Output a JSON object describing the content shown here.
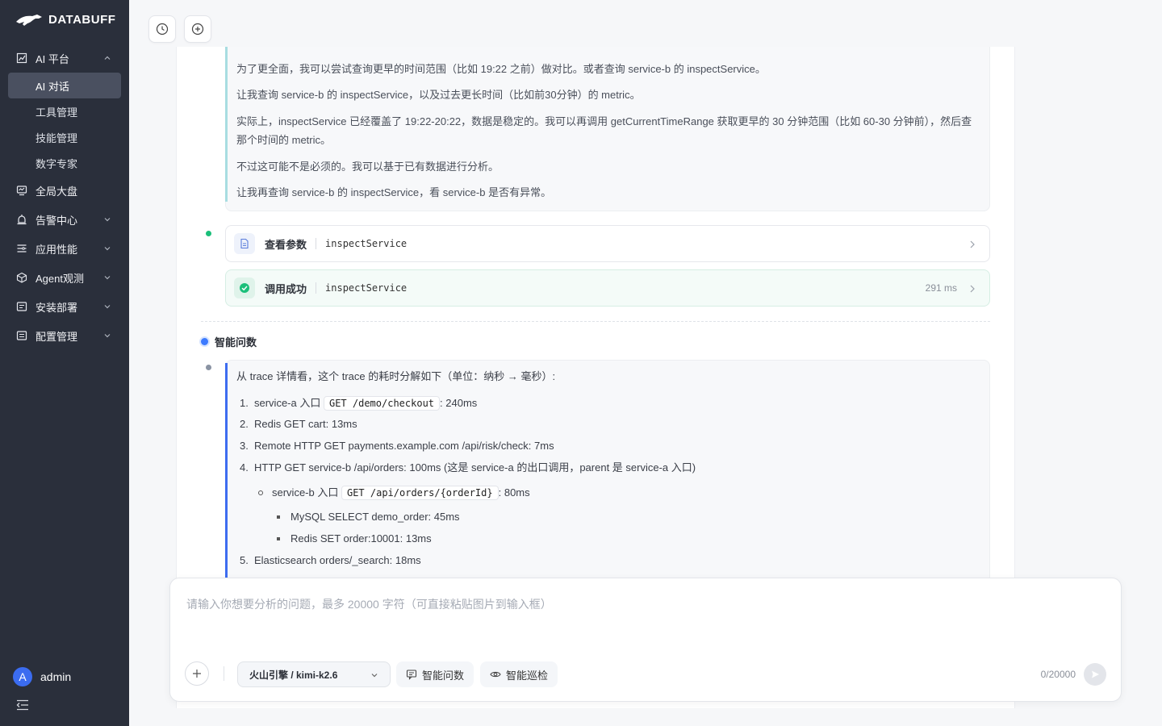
{
  "app": {
    "brand": "DATABUFF",
    "user": "admin",
    "user_initial": "A"
  },
  "sidebar": {
    "groups": [
      {
        "label": "AI 平台",
        "icon": "chart-line-icon",
        "expanded": true
      },
      {
        "label": "全局大盘",
        "icon": "monitor-icon"
      },
      {
        "label": "告警中心",
        "icon": "alarm-icon"
      },
      {
        "label": "应用性能",
        "icon": "list-icon"
      },
      {
        "label": "Agent观测",
        "icon": "cube-icon"
      },
      {
        "label": "安装部署",
        "icon": "document-icon"
      },
      {
        "label": "配置管理",
        "icon": "settings-doc-icon"
      }
    ],
    "ai_items": [
      "AI 对话",
      "工具管理",
      "技能管理",
      "数字专家"
    ],
    "active_item": "AI 对话"
  },
  "topbar": {
    "history_icon": "history-icon",
    "new_chat_icon": "plus-circle-icon"
  },
  "thinking": {
    "lines": [
      "为了更全面，我可以尝试查询更早的时间范围（比如 19:22 之前）做对比。或者查询 service-b 的 inspectService。",
      "让我查询 service-b 的 inspectService，以及过去更长时间（比如前30分钟）的 metric。",
      "实际上，inspectService 已经覆盖了 19:22-20:22，数据是稳定的。我可以再调用 getCurrentTimeRange 获取更早的 30 分钟范围（比如 60-30 分钟前），然后查那个时间的 metric。",
      "不过这可能不是必须的。我可以基于已有数据进行分析。",
      "让我再查询 service-b 的 inspectService，看 service-b 是否有异常。"
    ]
  },
  "tool_calls": [
    {
      "label": "查看参数",
      "name": "inspectService",
      "status": "params"
    },
    {
      "label": "调用成功",
      "name": "inspectService",
      "status": "success",
      "time": "291 ms"
    }
  ],
  "section": {
    "title": "智能问数"
  },
  "answer": {
    "intro": "从 trace 详情看，这个 trace 的耗时分解如下（单位：纳秒 → 毫秒）:",
    "items": [
      {
        "num": "1.",
        "pre": "service-a 入口",
        "code": "GET /demo/checkout",
        "post": ": 240ms"
      },
      {
        "num": "2.",
        "text": "Redis GET cart: 13ms"
      },
      {
        "num": "3.",
        "text": "Remote HTTP GET payments.example.com /api/risk/check: 7ms"
      },
      {
        "num": "4.",
        "text": "HTTP GET service-b /api/orders: 100ms (这是 service-a 的出口调用，parent 是 service-a 入口)"
      },
      {
        "num": "5.",
        "text": "Elasticsearch orders/_search: 18ms"
      }
    ],
    "sub_item": {
      "pre": "service-b 入口",
      "code": "GET /api/orders/{orderId}",
      "post": ": 80ms"
    },
    "sub_sub_items": [
      "MySQL SELECT demo_order: 45ms",
      "Redis SET order:10001: 13ms"
    ]
  },
  "input": {
    "placeholder": "请输入你想要分析的问题，最多 20000 字符（可直接粘贴图片到输入框）",
    "model": "火山引擎 / kimi-k2.6",
    "chip_ask": "智能问数",
    "chip_inspect": "智能巡检",
    "char_count": "0/20000"
  }
}
